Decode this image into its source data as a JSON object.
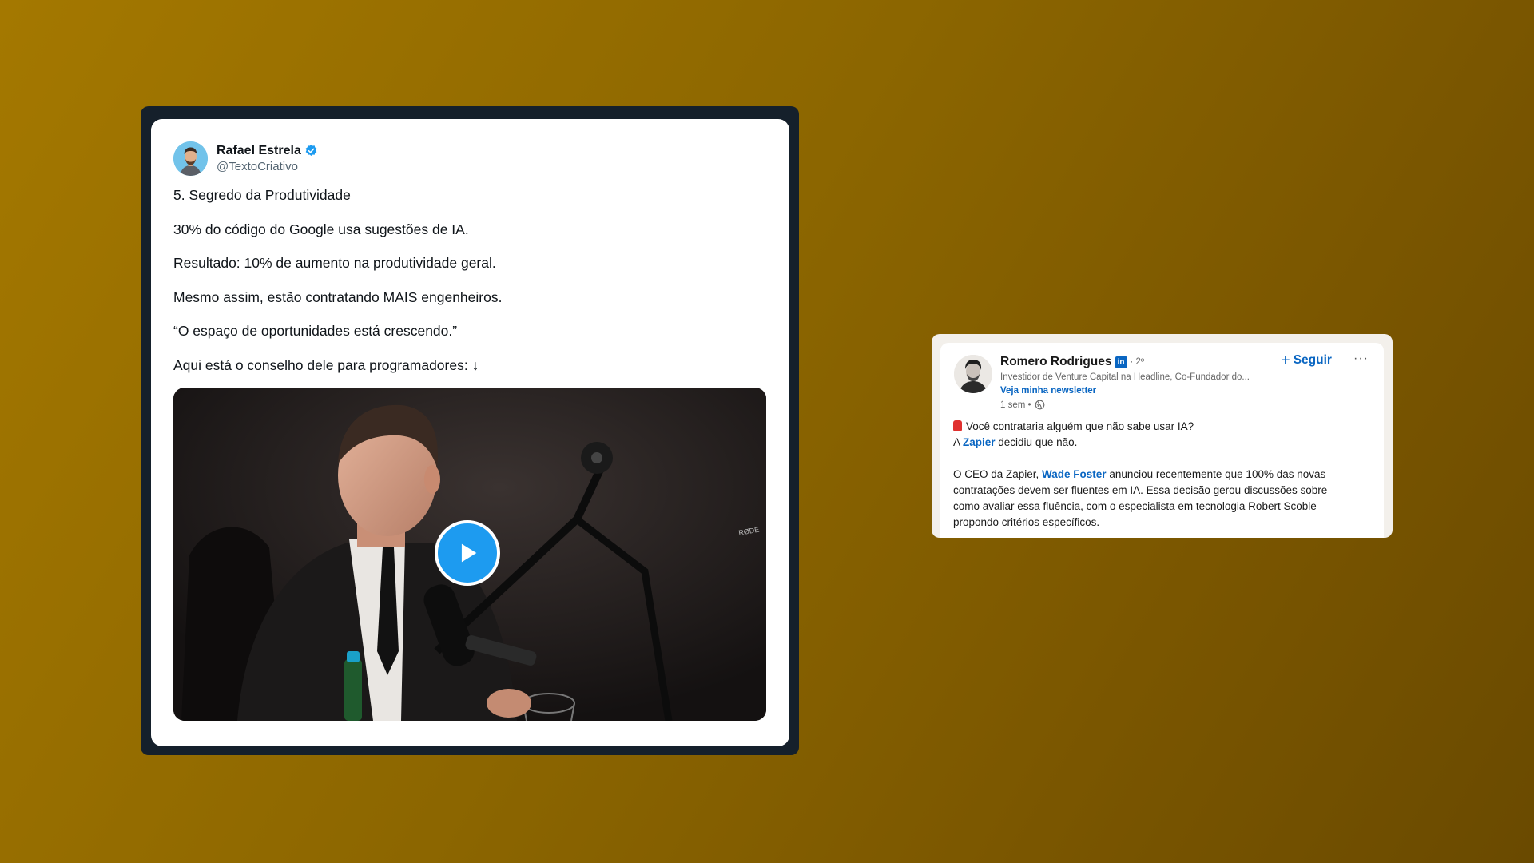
{
  "tweet": {
    "author_name": "Rafael Estrela",
    "author_handle": "@TextoCriativo",
    "lines": [
      "5. Segredo da Produtividade",
      "30% do código do Google usa sugestões de IA.",
      "Resultado: 10% de aumento na produtividade geral.",
      "Mesmo assim, estão contratando MAIS engenheiros.",
      "“O espaço de oportunidades está crescendo.”",
      "Aqui está o conselho dele para programadores: ↓"
    ],
    "video_mic_label": "RØDE"
  },
  "linkedin": {
    "author_name": "Romero Rodrigues",
    "badge_text": "in",
    "degree": "· 2º",
    "headline": "Investidor de Venture Capital na Headline, Co-Fundador do...",
    "newsletter_label": "Veja minha newsletter",
    "time": "1 sem •",
    "follow_label": "Seguir",
    "more_label": "···",
    "post": {
      "line1": "Você contrataria alguém que não sabe usar IA?",
      "line2_prefix": "A ",
      "line2_link": "Zapier",
      "line2_suffix": " decidiu que não.",
      "para2_prefix": "O CEO da Zapier, ",
      "para2_link": "Wade Foster",
      "para2_line1_rest": " anunciou recentemente que 100% das novas",
      "para2_line2": "contratações devem ser fluentes em IA. Essa decisão gerou discussões sobre",
      "para2_line3": "como avaliar essa fluência, com o especialista em tecnologia Robert Scoble",
      "para2_line4": "propondo critérios específicos."
    }
  },
  "colors": {
    "twitter_blue": "#1d9bf0",
    "linkedin_blue": "#0a66c2",
    "frame_dark": "#15202b"
  }
}
